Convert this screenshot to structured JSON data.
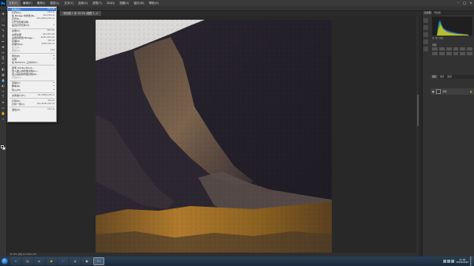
{
  "window": {
    "app_logo": "Ps",
    "menus": [
      "文件(F)",
      "编辑(E)",
      "图像(I)",
      "图层(L)",
      "文字(Y)",
      "选择(S)",
      "滤镜(T)",
      "3D(D)",
      "视图(V)",
      "窗口(W)",
      "帮助(H)"
    ],
    "active_menu_index": 0,
    "controls": [
      "–",
      "□",
      "×"
    ]
  },
  "document_tab": {
    "title": "未标题-1 @ 33.3% (图层 1, RGB/8)",
    "close": "×"
  },
  "file_menu": {
    "items": [
      {
        "label": "新建(N)...",
        "shortcut": "Ctrl+N",
        "highlighted": true
      },
      {
        "label": "打开(O)...",
        "shortcut": "Ctrl+O"
      },
      {
        "label": "在 Bridge 中浏览(B)...",
        "shortcut": "Alt+Ctrl+O"
      },
      {
        "label": "打开为...",
        "shortcut": "Alt+Shift+Ctrl+O"
      },
      {
        "label": "打开为智能对象...",
        "shortcut": ""
      },
      {
        "label": "最近打开文件(T)",
        "shortcut": "▸"
      },
      {
        "sep": true
      },
      {
        "label": "关闭(C)",
        "shortcut": "Ctrl+W"
      },
      {
        "label": "关闭全部",
        "shortcut": "Alt+Ctrl+W"
      },
      {
        "label": "关闭并转到 Bridge...",
        "shortcut": "Shift+Ctrl+W"
      },
      {
        "label": "存储(S)",
        "shortcut": "Ctrl+S"
      },
      {
        "label": "存储为(A)...",
        "shortcut": "Shift+Ctrl+S"
      },
      {
        "label": "签入(I)...",
        "shortcut": "",
        "dim": true
      },
      {
        "label": "恢复(V)",
        "shortcut": "F12",
        "dim": true
      },
      {
        "sep": true
      },
      {
        "label": "导出(E)",
        "shortcut": "▸"
      },
      {
        "label": "生成",
        "shortcut": "▸"
      },
      {
        "label": "在 Behance 上共享(D)...",
        "shortcut": ""
      },
      {
        "sep": true
      },
      {
        "label": "搜索 Adobe Stock...",
        "shortcut": ""
      },
      {
        "label": "置入嵌入的智能对象(L)...",
        "shortcut": ""
      },
      {
        "label": "置入链接的智能对象(K)...",
        "shortcut": ""
      },
      {
        "label": "打包(G)...",
        "shortcut": "",
        "dim": true
      },
      {
        "sep": true
      },
      {
        "label": "自动(U)",
        "shortcut": "▸"
      },
      {
        "label": "脚本(R)",
        "shortcut": "▸"
      },
      {
        "label": "导入(M)",
        "shortcut": "▸"
      },
      {
        "sep": true
      },
      {
        "label": "文件简介(F)...",
        "shortcut": "Alt+Shift+Ctrl+I"
      },
      {
        "sep": true
      },
      {
        "label": "打印(P)...",
        "shortcut": "Ctrl+P"
      },
      {
        "label": "打印一份(Y)",
        "shortcut": "Alt+Shift+Ctrl+P"
      },
      {
        "sep": true
      },
      {
        "label": "退出(X)",
        "shortcut": "Ctrl+Q"
      }
    ]
  },
  "tools": [
    "move-tool",
    "marquee-tool",
    "lasso-tool",
    "quick-select-tool",
    "crop-tool",
    "eyedropper-tool",
    "healing-brush-tool",
    "brush-tool",
    "clone-stamp-tool",
    "history-brush-tool",
    "eraser-tool",
    "gradient-tool",
    "blur-tool",
    "dodge-tool",
    "pen-tool",
    "type-tool",
    "path-select-tool",
    "rectangle-tool",
    "hand-tool",
    "zoom-tool"
  ],
  "tool_glyphs": [
    "✥",
    "⬚",
    "ᔓ",
    "✎",
    "⌗",
    "✒",
    "✚",
    "✏",
    "⎘",
    "↶",
    "◧",
    "▦",
    "💧",
    "◐",
    "✑",
    "T",
    "➤",
    "▭",
    "✋",
    "⌕"
  ],
  "panels": {
    "top_tabs": [
      "直方图",
      "导航器"
    ],
    "adjustments_title": "调整",
    "histogram_meta": "源: 整个图像",
    "layers_tabs": [
      "图层",
      "通道",
      "路径"
    ],
    "layer_name": "背景",
    "layer_lock": "🔒",
    "layer_eye": "●"
  },
  "statusbar": {
    "text": "33.33%  文档:24.7M/24.7M"
  },
  "taskbar": {
    "apps": [
      {
        "name": "internet-explorer-icon",
        "glyph": "e",
        "color": "#3a8fe0",
        "active": false
      },
      {
        "name": "file-explorer-icon",
        "glyph": "▤",
        "color": "#e8c25a",
        "active": false
      },
      {
        "name": "media-player-icon",
        "glyph": "▶",
        "color": "#4ab0e0",
        "active": false
      },
      {
        "name": "chrome-icon",
        "glyph": "◉",
        "color": "#e0c040",
        "active": false
      },
      {
        "name": "word-icon",
        "glyph": "W",
        "color": "#2a5cab",
        "active": false
      },
      {
        "name": "qq-icon",
        "glyph": "◕",
        "color": "#66aadd",
        "active": false
      },
      {
        "name": "terminal-icon",
        "glyph": "▣",
        "color": "#cccccc",
        "active": false
      },
      {
        "name": "photoshop-icon",
        "glyph": "Ps",
        "color": "#31a8ff",
        "active": true
      }
    ],
    "clock_time": "21:39",
    "clock_date": "2016/10/12"
  },
  "colors": {
    "accent": "#3d7bd6",
    "ps_blue": "#31a8ff",
    "ui_dark": "#282828"
  }
}
